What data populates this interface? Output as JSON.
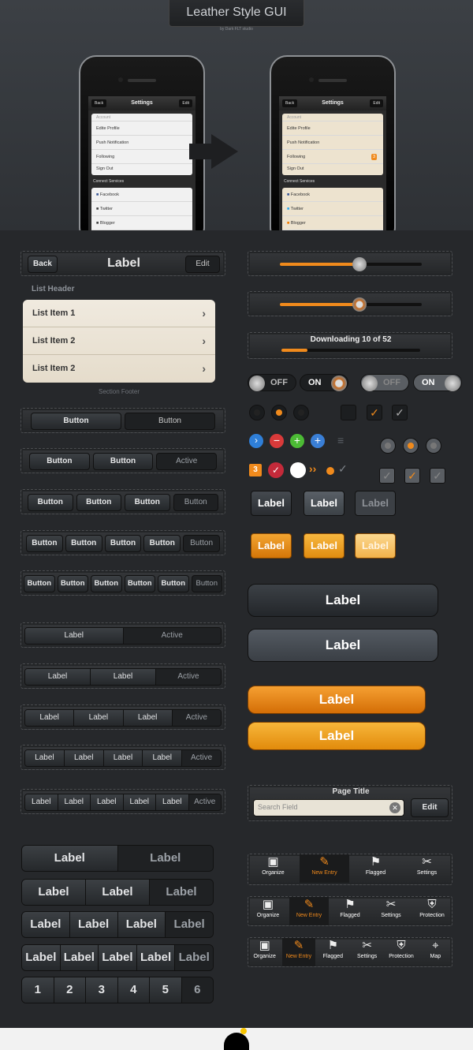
{
  "hero": {
    "title": "Leather Style GUI",
    "subtitle": "by Dark FLT studio",
    "phone": {
      "nav_title": "Settings",
      "back": "Back",
      "edit": "Edit",
      "section1": "Account",
      "rows1": [
        "Edite Profile",
        "Push Notification",
        "Following",
        "Sign Out"
      ],
      "badge": "3",
      "section2": "Connect Services",
      "rows2": [
        "Facebook",
        "Twitter",
        "Blogger"
      ]
    }
  },
  "nav": {
    "back": "Back",
    "title": "Label",
    "edit": "Edit"
  },
  "list": {
    "header": "List Header",
    "items": [
      "List Item 1",
      "List Item 2",
      "List Item 2"
    ],
    "footer": "Section Footer"
  },
  "button_bars": [
    [
      "Button",
      "Button"
    ],
    [
      "Button",
      "Button",
      "Active"
    ],
    [
      "Button",
      "Button",
      "Button",
      "Button"
    ],
    [
      "Button",
      "Button",
      "Button",
      "Button",
      "Button"
    ],
    [
      "Button",
      "Button",
      "Button",
      "Button",
      "Button",
      "Button"
    ]
  ],
  "segments": [
    [
      "Label",
      "Active"
    ],
    [
      "Label",
      "Label",
      "Active"
    ],
    [
      "Label",
      "Label",
      "Label",
      "Active"
    ],
    [
      "Label",
      "Label",
      "Label",
      "Label",
      "Active"
    ],
    [
      "Label",
      "Label",
      "Label",
      "Label",
      "Label",
      "Active"
    ]
  ],
  "big_segments": [
    [
      "Label",
      "Label"
    ],
    [
      "Label",
      "Label",
      "Label"
    ],
    [
      "Label",
      "Label",
      "Label",
      "Label"
    ],
    [
      "Label",
      "Label",
      "Label",
      "Label",
      "Label"
    ],
    [
      "1",
      "2",
      "3",
      "4",
      "5",
      "6"
    ]
  ],
  "sliders": {
    "slider1_value": 0.56,
    "slider2_value": 0.56,
    "download_label": "Downloading 10 of 52",
    "download_progress": 0.19
  },
  "toggles": {
    "off": "OFF",
    "on": "ON"
  },
  "badge_count": "3",
  "label_buttons": {
    "dark": [
      "Label",
      "Label",
      "Label"
    ],
    "orange": [
      "Label",
      "Label",
      "Label"
    ]
  },
  "big_buttons": [
    "Label",
    "Label",
    "Label",
    "Label"
  ],
  "search_bar": {
    "title": "Page Title",
    "placeholder": "Search Field",
    "edit": "Edit"
  },
  "tabbars": [
    [
      "Organize",
      "New Entry",
      "Flagged",
      "Settings"
    ],
    [
      "Organize",
      "New Entry",
      "Flagged",
      "Settings",
      "Protection"
    ],
    [
      "Organize",
      "New Entry",
      "Flagged",
      "Settings",
      "Protection",
      "Map"
    ]
  ],
  "tab_icons": {
    "Organize": "archive-icon",
    "New Entry": "edit-icon",
    "Flagged": "flag-icon",
    "Settings": "tools-icon",
    "Protection": "shield-icon",
    "Map": "map-pin-icon"
  },
  "colors": {
    "accent": "#f08a1c",
    "leather_dark": "#26282b",
    "cream": "#ede5d6"
  }
}
